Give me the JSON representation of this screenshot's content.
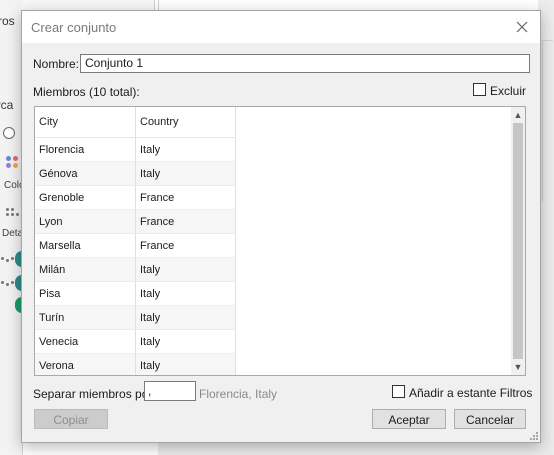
{
  "background": {
    "filters_label": "ltros",
    "marks_label": "arca",
    "color_label": "Colo",
    "detail_label": "Deta"
  },
  "dialog": {
    "title": "Crear conjunto",
    "name_label": "Nombre:",
    "name_value": "Conjunto 1",
    "members_label": "Miembros (10 total):",
    "exclude_label": "Excluir",
    "exclude_checked": false,
    "table": {
      "columns": [
        "City",
        "Country"
      ],
      "rows": [
        [
          "Florencia",
          "Italy"
        ],
        [
          "Génova",
          "Italy"
        ],
        [
          "Grenoble",
          "France"
        ],
        [
          "Lyon",
          "France"
        ],
        [
          "Marsella",
          "France"
        ],
        [
          "Milán",
          "Italy"
        ],
        [
          "Pisa",
          "Italy"
        ],
        [
          "Turín",
          "Italy"
        ],
        [
          "Venecia",
          "Italy"
        ],
        [
          "Verona",
          "Italy"
        ]
      ]
    },
    "separator_label": "Separar miembros por",
    "separator_value": ",",
    "separator_preview": "Florencia, Italy",
    "add_to_filters_label": "Añadir a estante Filtros",
    "add_to_filters_checked": false,
    "copy_button": "Copiar",
    "accept_button": "Aceptar",
    "cancel_button": "Cancelar"
  },
  "colors": {
    "dialog_bg": "#f0f0f0",
    "title_text": "#7a7a7a",
    "row_alt": "#f6f6f6",
    "disabled_button": "#cccccc",
    "button": "#e1e1e1",
    "pill_teal": "#2e8b8b",
    "pill_green": "#1a9a6c"
  }
}
